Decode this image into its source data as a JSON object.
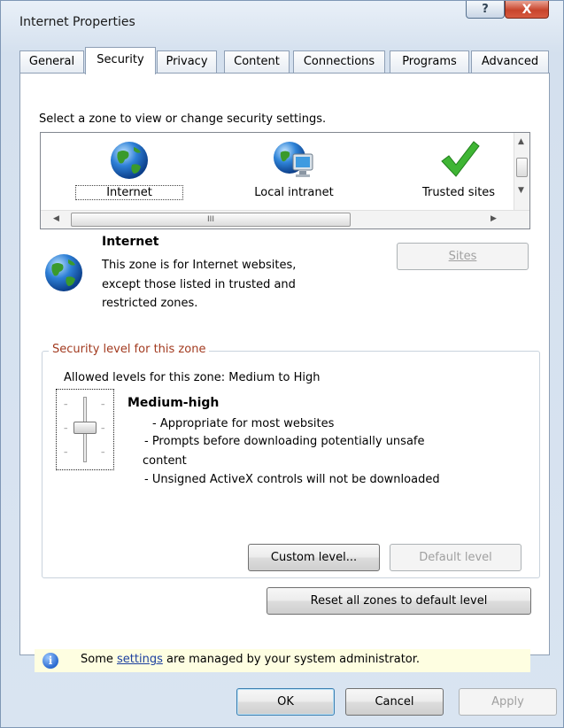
{
  "window": {
    "title": "Internet Properties",
    "help_label": "?",
    "close_label": "X"
  },
  "tabs": [
    {
      "label": "General"
    },
    {
      "label": "Security"
    },
    {
      "label": "Privacy"
    },
    {
      "label": "Content"
    },
    {
      "label": "Connections"
    },
    {
      "label": "Programs"
    },
    {
      "label": "Advanced"
    }
  ],
  "active_tab": "Security",
  "zones": {
    "prompt": "Select a zone to view or change security settings.",
    "items": [
      {
        "label": "Internet",
        "icon": "globe-icon"
      },
      {
        "label": "Local intranet",
        "icon": "intranet-globe-monitor-icon"
      },
      {
        "label": "Trusted sites",
        "icon": "green-checkmark-icon"
      }
    ],
    "scroll_thumb_glyph": "III"
  },
  "selected_zone": {
    "name": "Internet",
    "description_lines": [
      "This zone is for Internet websites,",
      "except those listed in trusted and",
      "restricted zones."
    ],
    "sites_button": "Sites"
  },
  "security_level": {
    "group_title": "Security level for this zone",
    "allowed": "Allowed levels for this zone: Medium to High",
    "level_name": "Medium-high",
    "bullets": [
      "- Appropriate for most websites",
      "- Prompts before downloading potentially unsafe",
      "content",
      "- Unsigned ActiveX controls will not be downloaded"
    ],
    "custom_level_button": "Custom level...",
    "default_level_button": "Default level"
  },
  "reset_button": "Reset all zones to default level",
  "info_bar": {
    "before": "Some ",
    "link": "settings",
    "after": " are managed by your system administrator."
  },
  "buttons": {
    "ok": "OK",
    "cancel": "Cancel",
    "apply": "Apply"
  },
  "colors": {
    "group_title": "#a23a1f",
    "info_bar_bg": "#fefee1",
    "link": "#1c3f9e"
  }
}
